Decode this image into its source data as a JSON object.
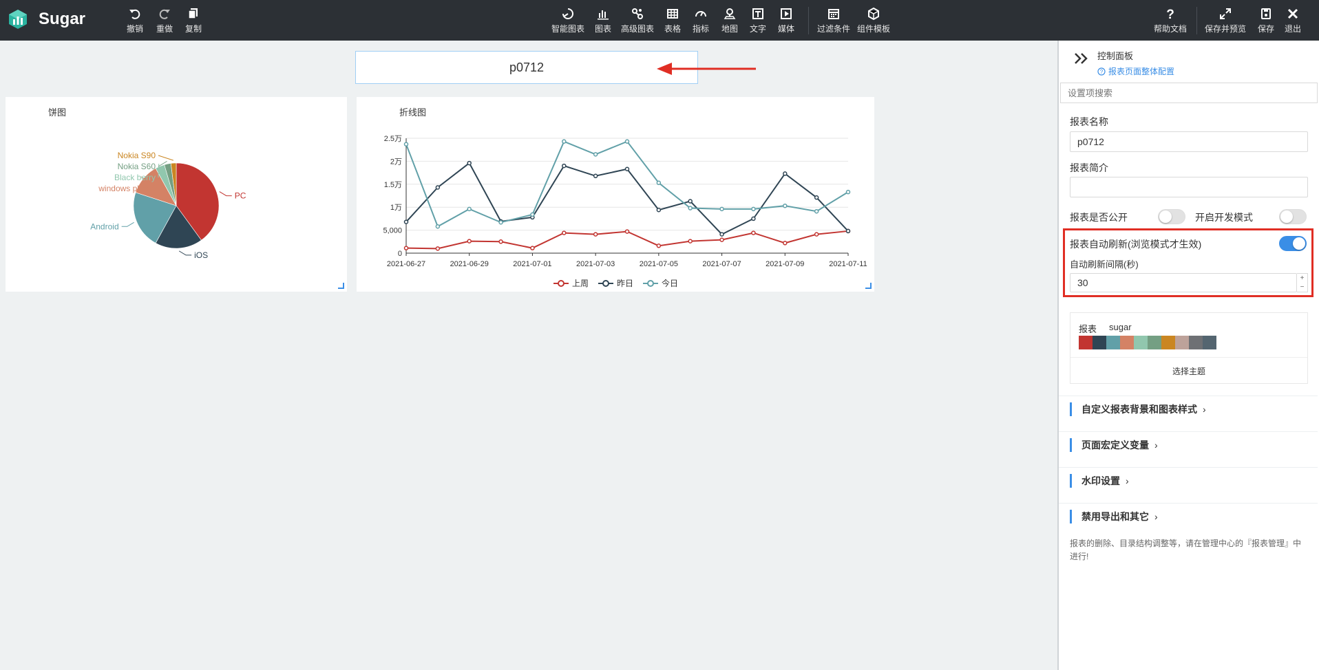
{
  "app": {
    "name": "Sugar"
  },
  "toolbar": {
    "left": [
      {
        "label": "撤销",
        "icon": "undo-icon"
      },
      {
        "label": "重做",
        "icon": "redo-icon"
      },
      {
        "label": "复制",
        "icon": "copy-icon"
      }
    ],
    "center": [
      {
        "label": "智能图表",
        "icon": "smart-chart-icon"
      },
      {
        "label": "图表",
        "icon": "bar-chart-icon"
      },
      {
        "label": "高级图表",
        "icon": "advanced-chart-icon"
      },
      {
        "label": "表格",
        "icon": "table-icon"
      },
      {
        "label": "指标",
        "icon": "gauge-icon"
      },
      {
        "label": "地图",
        "icon": "map-pin-icon"
      },
      {
        "label": "文字",
        "icon": "text-icon"
      },
      {
        "label": "媒体",
        "icon": "media-icon"
      },
      {
        "label": "过滤条件",
        "icon": "calendar-filter-icon"
      },
      {
        "label": "组件模板",
        "icon": "template-icon"
      }
    ],
    "right": [
      {
        "label": "帮助文档",
        "icon": "help-icon"
      },
      {
        "label": "保存并预览",
        "icon": "expand-icon"
      },
      {
        "label": "保存",
        "icon": "save-icon"
      },
      {
        "label": "退出",
        "icon": "close-icon"
      }
    ]
  },
  "canvas": {
    "report_title": "p0712",
    "annotation_color": "#e02e24"
  },
  "pie_card": {
    "title": "饼图",
    "chart_data": {
      "type": "pie",
      "slices": [
        {
          "label": "PC",
          "value": 40,
          "color": "#c23531"
        },
        {
          "label": "iOS",
          "value": 18,
          "color": "#2f4554"
        },
        {
          "label": "Android",
          "value": 22,
          "color": "#61a0a8"
        },
        {
          "label": "windows phone",
          "value": 12,
          "color": "#d48265"
        },
        {
          "label": "Black berry",
          "value": 3.5,
          "color": "#91c7ae"
        },
        {
          "label": "Nokia S60",
          "value": 2.5,
          "color": "#749f83"
        },
        {
          "label": "Nokia S90",
          "value": 2,
          "color": "#ca8622"
        }
      ]
    }
  },
  "line_card": {
    "title": "折线图",
    "chart_data": {
      "type": "line",
      "x": [
        "2021-06-27",
        "2021-06-28",
        "2021-06-29",
        "2021-06-30",
        "2021-07-01",
        "2021-07-02",
        "2021-07-03",
        "2021-07-04",
        "2021-07-05",
        "2021-07-06",
        "2021-07-07",
        "2021-07-08",
        "2021-07-09",
        "2021-07-10",
        "2021-07-11"
      ],
      "x_tick_labels": [
        "2021-06-27",
        "2021-06-29",
        "2021-07-01",
        "2021-07-03",
        "2021-07-05",
        "2021-07-07",
        "2021-07-09",
        "2021-07-11"
      ],
      "y_tick_labels": [
        "0",
        "5,000",
        "1万",
        "1.5万",
        "2万",
        "2.5万"
      ],
      "ylim": [
        0,
        25000
      ],
      "series": [
        {
          "name": "上周",
          "color": "#c23531",
          "values": [
            1100,
            1000,
            2600,
            2500,
            1100,
            4400,
            4100,
            4700,
            1600,
            2600,
            2900,
            4400,
            2200,
            4100,
            4800
          ]
        },
        {
          "name": "昨日",
          "color": "#2f4554",
          "values": [
            6800,
            14300,
            19600,
            6900,
            7800,
            19000,
            16800,
            18300,
            9400,
            11300,
            4100,
            7500,
            17300,
            12100,
            4800
          ]
        },
        {
          "name": "今日",
          "color": "#61a0a8",
          "values": [
            23700,
            5800,
            9600,
            6700,
            8400,
            24300,
            21500,
            24300,
            15300,
            9800,
            9600,
            9600,
            10300,
            9100,
            13300
          ]
        }
      ]
    }
  },
  "panel": {
    "title": "控制面板",
    "subtitle": "报表页面整体配置",
    "search_placeholder": "设置项搜索",
    "report_name_label": "报表名称",
    "report_name_value": "p0712",
    "report_intro_label": "报表简介",
    "report_intro_value": "",
    "public_label": "报表是否公开",
    "public_on": false,
    "dev_mode_label": "开启开发模式",
    "dev_mode_on": false,
    "auto_refresh_label": "报表自动刷新(浏览模式才生效)",
    "auto_refresh_on": true,
    "interval_label": "自动刷新间隔(秒)",
    "interval_value": "30",
    "stepper_plus": "+",
    "stepper_minus": "−",
    "theme_label": "报表",
    "theme_name": "sugar",
    "theme_colors": [
      "#c23531",
      "#2f4554",
      "#61a0a8",
      "#d48265",
      "#91c7ae",
      "#749f83",
      "#ca8622",
      "#bda29a",
      "#6e7074",
      "#546570"
    ],
    "choose_theme": "选择主题",
    "sections": [
      "自定义报表背景和图表样式",
      "页面宏定义变量",
      "水印设置",
      "禁用导出和其它"
    ],
    "footer_note": "报表的删除、目录结构调整等，请在管理中心的『报表管理』中进行!"
  }
}
